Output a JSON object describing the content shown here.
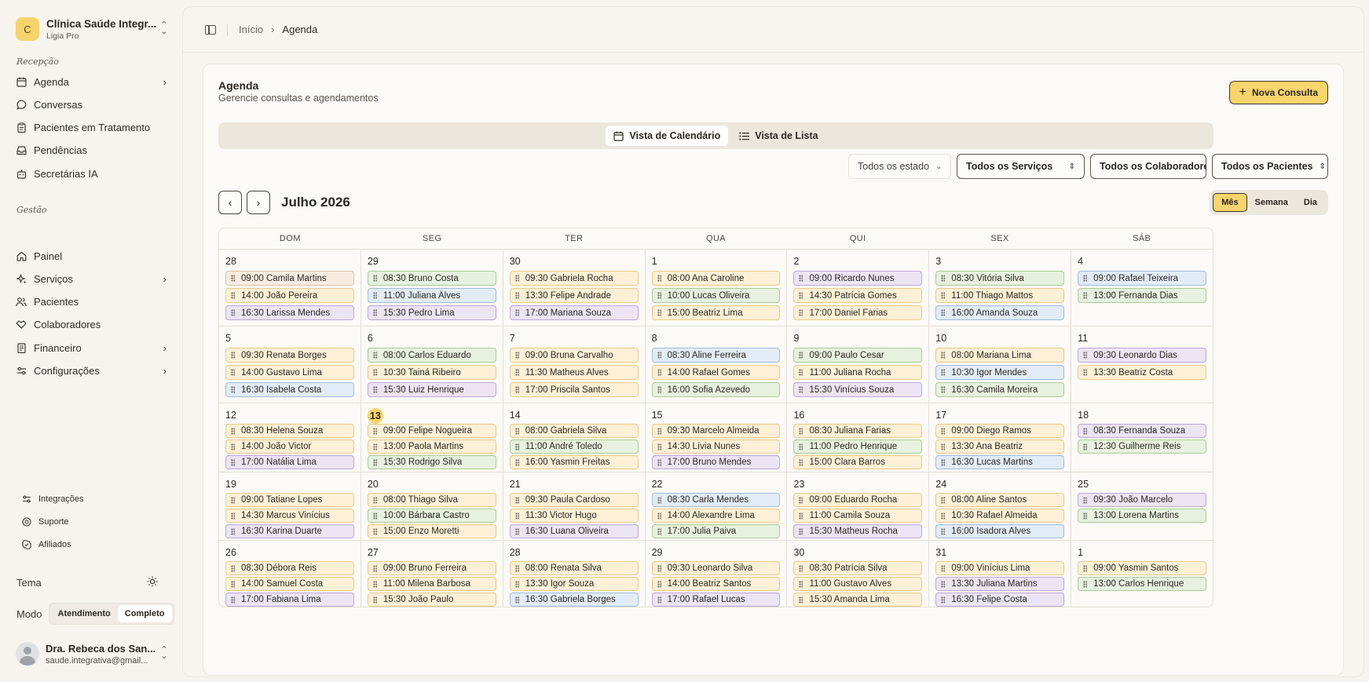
{
  "org": {
    "logo_letter": "C",
    "name": "Clínica Saúde Integr...",
    "plan": "Ligia Pro"
  },
  "sidebar": {
    "section_reception": "Recepção",
    "reception_items": [
      {
        "label": "Agenda",
        "icon": "calendar-icon",
        "chevron": true
      },
      {
        "label": "Conversas",
        "icon": "chat-icon",
        "chevron": false
      },
      {
        "label": "Pacientes em Tratamento",
        "icon": "clipboard-icon",
        "chevron": false
      },
      {
        "label": "Pendências",
        "icon": "inbox-icon",
        "chevron": false
      },
      {
        "label": "Secretárias IA",
        "icon": "bot-icon",
        "chevron": false
      }
    ],
    "section_management": "Gestão",
    "management_items": [
      {
        "label": "Painel",
        "icon": "home-icon",
        "chevron": false
      },
      {
        "label": "Serviços",
        "icon": "sparkle-icon",
        "chevron": true
      },
      {
        "label": "Pacientes",
        "icon": "users-icon",
        "chevron": false
      },
      {
        "label": "Colaboradores",
        "icon": "handshake-icon",
        "chevron": false
      },
      {
        "label": "Financeiro",
        "icon": "ledger-icon",
        "chevron": true
      },
      {
        "label": "Configurações",
        "icon": "sliders-icon",
        "chevron": true
      }
    ],
    "footer_items": [
      {
        "label": "Integrações",
        "icon": "plug-icon"
      },
      {
        "label": "Suporte",
        "icon": "help-icon"
      },
      {
        "label": "Afiliados",
        "icon": "badge-icon"
      }
    ],
    "theme_label": "Tema",
    "mode_label": "Modo",
    "mode_options": [
      "Atendimento",
      "Completo"
    ],
    "mode_selected": "Completo",
    "user_name": "Dra. Rebeca dos San...",
    "user_email": "saude.integrativa@gmail..."
  },
  "breadcrumb": {
    "home": "Início",
    "current": "Agenda"
  },
  "page": {
    "title": "Agenda",
    "subtitle": "Gerencie consultas e agendamentos",
    "new_button": "Nova Consulta",
    "view_tabs": [
      "Vista de Calendário",
      "Vista de Lista"
    ],
    "view_selected": "Vista de Calendário",
    "filters": [
      "Todos os estado",
      "Todos os Serviços",
      "Todos os Colaboradores",
      "Todos os Pacientes"
    ],
    "month_title": "Julho 2026",
    "range_options": [
      "Mês",
      "Semana",
      "Dia"
    ],
    "range_selected": "Mês"
  },
  "colors": {
    "accent": "#f7d46c",
    "event_orange": "#fdf0d6",
    "event_green": "#e6f1df",
    "event_blue": "#e2ecf6",
    "event_purple": "#ece4f3"
  },
  "calendar": {
    "weekdays": [
      "DOM",
      "SEG",
      "TER",
      "QUA",
      "QUI",
      "SEX",
      "SÁB"
    ],
    "today": "13",
    "weeks": [
      [
        {
          "day": "28",
          "events": [
            [
              "09:00 Camila Martins",
              "peach"
            ],
            [
              "14:00 João Pereira",
              "orange"
            ],
            [
              "16:30 Larissa Mendes",
              "purple"
            ]
          ]
        },
        {
          "day": "29",
          "events": [
            [
              "08:30 Bruno Costa",
              "green"
            ],
            [
              "11:00 Juliana Alves",
              "blue"
            ],
            [
              "15:30 Pedro Lima",
              "purple"
            ]
          ]
        },
        {
          "day": "30",
          "events": [
            [
              "09:30 Gabriela Rocha",
              "orange"
            ],
            [
              "13:30 Felipe Andrade",
              "orange"
            ],
            [
              "17:00 Mariana Souza",
              "purple"
            ]
          ]
        },
        {
          "day": "1",
          "events": [
            [
              "08:00 Ana Caroline",
              "orange"
            ],
            [
              "10:00 Lucas Oliveira",
              "green"
            ],
            [
              "15:00 Beatriz Lima",
              "orange"
            ]
          ]
        },
        {
          "day": "2",
          "events": [
            [
              "09:00 Ricardo Nunes",
              "purple"
            ],
            [
              "14:30 Patrícia Gomes",
              "orange"
            ],
            [
              "17:00 Daniel Farias",
              "orange"
            ]
          ]
        },
        {
          "day": "3",
          "events": [
            [
              "08:30 Vitória Silva",
              "green"
            ],
            [
              "11:00 Thiago Mattos",
              "orange"
            ],
            [
              "16:00 Amanda Souza",
              "blue"
            ]
          ]
        },
        {
          "day": "4",
          "events": [
            [
              "09:00 Rafael Teixeira",
              "blue"
            ],
            [
              "13:00 Fernanda Dias",
              "green"
            ]
          ]
        }
      ],
      [
        {
          "day": "5",
          "events": [
            [
              "09:30 Renata Borges",
              "orange"
            ],
            [
              "14:00 Gustavo Lima",
              "orange"
            ],
            [
              "16:30 Isabela Costa",
              "blue"
            ]
          ]
        },
        {
          "day": "6",
          "events": [
            [
              "08:00 Carlos Eduardo",
              "green"
            ],
            [
              "10:30 Tainá Ribeiro",
              "orange"
            ],
            [
              "15:30 Luiz Henrique",
              "purple"
            ]
          ]
        },
        {
          "day": "7",
          "events": [
            [
              "09:00 Bruna Carvalho",
              "orange"
            ],
            [
              "11:30 Matheus Alves",
              "orange"
            ],
            [
              "17:00 Priscila Santos",
              "orange"
            ]
          ]
        },
        {
          "day": "8",
          "events": [
            [
              "08:30 Aline Ferreira",
              "blue"
            ],
            [
              "14:00 Rafael Gomes",
              "orange"
            ],
            [
              "16:00 Sofia Azevedo",
              "green"
            ]
          ]
        },
        {
          "day": "9",
          "events": [
            [
              "09:00 Paulo Cesar",
              "green"
            ],
            [
              "11:00 Juliana Rocha",
              "orange"
            ],
            [
              "15:30 Vinícius Souza",
              "purple"
            ]
          ]
        },
        {
          "day": "10",
          "events": [
            [
              "08:00 Mariana Lima",
              "orange"
            ],
            [
              "10:30 Igor Mendes",
              "blue"
            ],
            [
              "16:30 Camila Moreira",
              "green"
            ]
          ]
        },
        {
          "day": "11",
          "events": [
            [
              "09:30 Leonardo Dias",
              "purple"
            ],
            [
              "13:30 Beatriz Costa",
              "orange"
            ]
          ]
        }
      ],
      [
        {
          "day": "12",
          "events": [
            [
              "08:30 Helena Souza",
              "orange"
            ],
            [
              "14:00 João Victor",
              "orange"
            ],
            [
              "17:00 Natália Lima",
              "purple"
            ]
          ]
        },
        {
          "day": "13",
          "events": [
            [
              "09:00 Felipe Nogueira",
              "orange"
            ],
            [
              "13:00 Paola Martins",
              "orange"
            ],
            [
              "15:30 Rodrigo Silva",
              "green"
            ]
          ]
        },
        {
          "day": "14",
          "events": [
            [
              "08:00 Gabriela Silva",
              "orange"
            ],
            [
              "11:00 André Toledo",
              "green"
            ],
            [
              "16:00 Yasmin Freitas",
              "orange"
            ]
          ]
        },
        {
          "day": "15",
          "events": [
            [
              "09:30 Marcelo Almeida",
              "orange"
            ],
            [
              "14:30 Lívia Nunes",
              "orange"
            ],
            [
              "17:00 Bruno Mendes",
              "purple"
            ]
          ]
        },
        {
          "day": "16",
          "events": [
            [
              "08:30 Juliana Farias",
              "orange"
            ],
            [
              "11:00 Pedro Henrique",
              "green"
            ],
            [
              "15:00 Clara Barros",
              "orange"
            ]
          ]
        },
        {
          "day": "17",
          "events": [
            [
              "09:00 Diego Ramos",
              "orange"
            ],
            [
              "13:30 Ana Beatriz",
              "orange"
            ],
            [
              "16:30 Lucas Martins",
              "blue"
            ]
          ]
        },
        {
          "day": "18",
          "events": [
            [
              "08:30 Fernanda Souza",
              "purple"
            ],
            [
              "12:30 Guilherme Reis",
              "green"
            ]
          ]
        }
      ],
      [
        {
          "day": "19",
          "events": [
            [
              "09:00 Tatiane Lopes",
              "orange"
            ],
            [
              "14:30 Marcus Vinícius",
              "orange"
            ],
            [
              "16:30 Karina Duarte",
              "purple"
            ]
          ]
        },
        {
          "day": "20",
          "events": [
            [
              "08:00 Thiago Silva",
              "orange"
            ],
            [
              "10:00 Bárbara Castro",
              "green"
            ],
            [
              "15:00 Enzo Moretti",
              "orange"
            ]
          ]
        },
        {
          "day": "21",
          "events": [
            [
              "09:30 Paula Cardoso",
              "orange"
            ],
            [
              "11:30 Victor Hugo",
              "orange"
            ],
            [
              "16:30 Luana Oliveira",
              "purple"
            ]
          ]
        },
        {
          "day": "22",
          "events": [
            [
              "08:30 Carla Mendes",
              "blue"
            ],
            [
              "14:00 Alexandre Lima",
              "orange"
            ],
            [
              "17:00 Julia Paiva",
              "green"
            ]
          ]
        },
        {
          "day": "23",
          "events": [
            [
              "09:00 Eduardo Rocha",
              "orange"
            ],
            [
              "11:00 Camila Souza",
              "orange"
            ],
            [
              "15:30 Matheus Rocha",
              "purple"
            ]
          ]
        },
        {
          "day": "24",
          "events": [
            [
              "08:00 Aline Santos",
              "orange"
            ],
            [
              "10:30 Rafael Almeida",
              "orange"
            ],
            [
              "16:00 Isadora Alves",
              "blue"
            ]
          ]
        },
        {
          "day": "25",
          "events": [
            [
              "09:30 João Marcelo",
              "purple"
            ],
            [
              "13:00 Lorena Martins",
              "green"
            ]
          ]
        }
      ],
      [
        {
          "day": "26",
          "events": [
            [
              "08:30 Débora Reis",
              "orange"
            ],
            [
              "14:00 Samuel Costa",
              "orange"
            ],
            [
              "17:00 Fabiana Lima",
              "purple"
            ]
          ]
        },
        {
          "day": "27",
          "events": [
            [
              "09:00 Bruno Ferreira",
              "orange"
            ],
            [
              "11:00 Milena Barbosa",
              "orange"
            ],
            [
              "15:30 João Paulo",
              "orange"
            ]
          ]
        },
        {
          "day": "28",
          "events": [
            [
              "08:00 Renata Silva",
              "orange"
            ],
            [
              "13:30 Igor Souza",
              "orange"
            ],
            [
              "16:30 Gabriela Borges",
              "blue"
            ]
          ]
        },
        {
          "day": "29",
          "events": [
            [
              "09:30 Leonardo Silva",
              "orange"
            ],
            [
              "14:00 Beatriz Santos",
              "orange"
            ],
            [
              "17:00 Rafael Lucas",
              "purple"
            ]
          ]
        },
        {
          "day": "30",
          "events": [
            [
              "08:30 Patrícia Silva",
              "orange"
            ],
            [
              "11:00 Gustavo Alves",
              "orange"
            ],
            [
              "15:30 Amanda Lima",
              "orange"
            ]
          ]
        },
        {
          "day": "31",
          "events": [
            [
              "09:00 Vinícius Lima",
              "orange"
            ],
            [
              "13:30 Juliana Martins",
              "purple"
            ],
            [
              "16:30 Felipe Costa",
              "purple"
            ]
          ]
        },
        {
          "day": "1",
          "events": [
            [
              "09:00 Yasmin Santos",
              "orange"
            ],
            [
              "13:00 Carlos Henrique",
              "green"
            ]
          ]
        }
      ]
    ]
  }
}
